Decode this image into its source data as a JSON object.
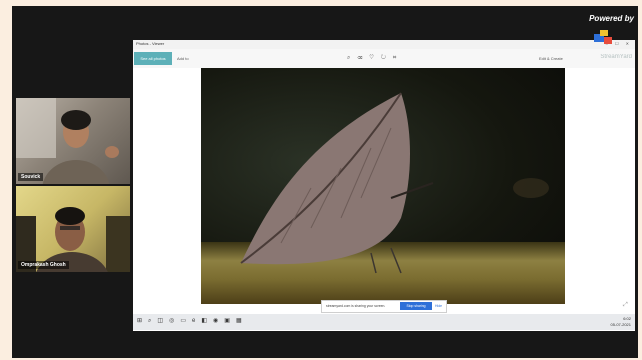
{
  "branding": {
    "powered_by": "Powered by",
    "name": "StreamYard"
  },
  "participants": [
    {
      "name": "Souvick"
    },
    {
      "name": "Omprakash Ghosh"
    }
  ],
  "viewer": {
    "title": "Photos - Viewer",
    "toolbar": {
      "primary": "See all photos",
      "add": "Add to",
      "right": "Edit & Create"
    }
  },
  "screen_share": {
    "message": "streamyard.com is sharing your screen.",
    "stop_label": "Stop sharing",
    "hide_label": "Hide"
  },
  "taskbar": {
    "time": "6:02",
    "date": "05-07-2021"
  },
  "colors": {
    "accent": "#5db0b8",
    "share_button": "#2d6fd8"
  }
}
